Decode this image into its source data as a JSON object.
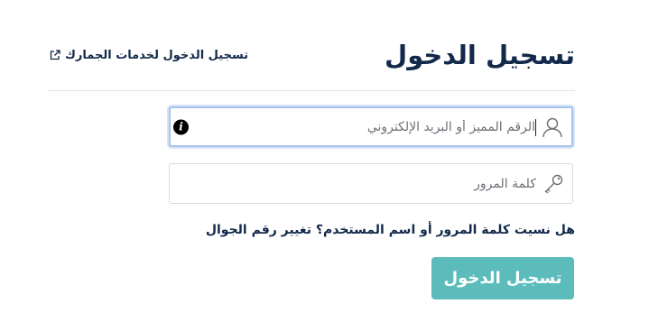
{
  "header": {
    "title": "تسجيل الدخول",
    "customs_link_label": "تسجيل الدخول لخدمات الجمارك"
  },
  "form": {
    "username": {
      "placeholder": "الرقم المميز أو البريد الإلكتروني",
      "value": "",
      "icon": "user-icon",
      "info_icon": "info-icon",
      "info_glyph": "i"
    },
    "password": {
      "placeholder": "كلمة المرور",
      "value": "",
      "icon": "key-icon"
    },
    "help": {
      "forgot_label": "هل نسيت كلمة المرور أو اسم المستخدم؟",
      "change_mobile_label": "تغيير رقم الجوال"
    },
    "submit_label": "تسجيل الدخول"
  },
  "colors": {
    "title": "#13294b",
    "button": "#5cbcbc",
    "focus_border": "#a7c2eb"
  }
}
